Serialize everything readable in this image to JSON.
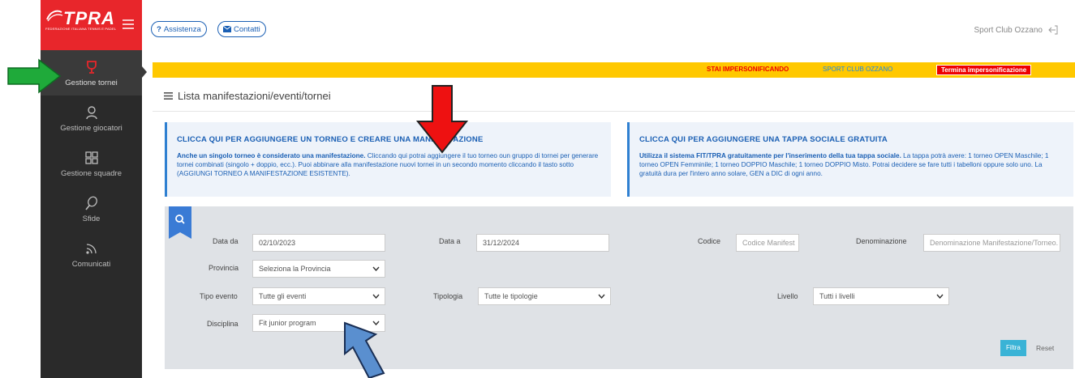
{
  "app": {
    "logo_text": "TPRA",
    "logo_subtitle": "FEDERAZIONE ITALIANA TENNIS E PADEL"
  },
  "sidebar": {
    "items": [
      {
        "label": "Gestione tornei",
        "icon": "trophy-icon",
        "active": true
      },
      {
        "label": "Gestione giocatori",
        "icon": "player-icon",
        "active": false
      },
      {
        "label": "Gestione squadre",
        "icon": "grid-icon",
        "active": false
      },
      {
        "label": "Sfide",
        "icon": "racket-icon",
        "active": false
      },
      {
        "label": "Comunicati",
        "icon": "broadcast-icon",
        "active": false
      }
    ]
  },
  "topbar": {
    "help_label": "Assistenza",
    "help_icon": "?",
    "contact_label": "Contatti",
    "club_name": "Sport Club Ozzano"
  },
  "impersonation": {
    "label": "STAI IMPERSONIFICANDO",
    "club": "SPORT CLUB OZZANO",
    "end_button": "Termina impersonificazione"
  },
  "page": {
    "title": "Lista manifestazioni/eventi/tornei"
  },
  "cards": {
    "left": {
      "title": "CLICCA QUI PER AGGIUNGERE UN TORNEO E CREARE UNA MANIFESTAZIONE",
      "bold": "Anche un singolo torneo è considerato una manifestazione.",
      "text": " Cliccando qui potrai aggiungere il tuo torneo oun gruppo di tornei per generare tornei combinati (singolo + doppio, ecc.). Puoi abbinare alla manifestazione nuovi tornei in un secondo momento cliccando il tasto sotto (AGGIUNGI TORNEO A MANIFESTAZIONE ESISTENTE)."
    },
    "right": {
      "title": "CLICCA QUI PER AGGIUNGERE UNA TAPPA SOCIALE GRATUITA",
      "bold": "Utilizza il sistema FIT/TPRA gratuitamente per l'inserimento della tua tappa sociale.",
      "text": " La tappa potrà avere: 1 torneo OPEN Maschile; 1 torneo OPEN Femminile; 1 torneo DOPPIO Maschile; 1 torneo DOPPIO Misto. Potrai decidere se fare tutti i tabelloni oppure solo uno. La gratuità dura per l'intero anno solare, GEN a DIC di ogni anno."
    }
  },
  "filters": {
    "data_da_label": "Data da",
    "data_da_value": "02/10/2023",
    "data_a_label": "Data a",
    "data_a_value": "31/12/2024",
    "codice_label": "Codice",
    "codice_placeholder": "Codice Manifest",
    "denominazione_label": "Denominazione",
    "denominazione_placeholder": "Denominazione Manifestazione/Torneo.",
    "provincia_label": "Provincia",
    "provincia_value": "Seleziona la Provincia",
    "tipo_evento_label": "Tipo evento",
    "tipo_evento_value": "Tutte gli eventi",
    "tipologia_label": "Tipologia",
    "tipologia_value": "Tutte le tipologie",
    "livello_label": "Livello",
    "livello_value": "Tutti i livelli",
    "disciplina_label": "Disciplina",
    "disciplina_value": "Fit junior program",
    "filtra_label": "Filtra",
    "reset_label": "Reset"
  },
  "colors": {
    "sidebar_bg": "#2a2a2a",
    "logo_red": "#e8262b",
    "impersonation_yellow": "#ffc800",
    "accent_blue": "#1a5fb4",
    "filter_button": "#3ab3d6",
    "annotation_green": "#1faa3a",
    "annotation_red": "#ee1111",
    "annotation_blue": "#5a8fcf"
  }
}
